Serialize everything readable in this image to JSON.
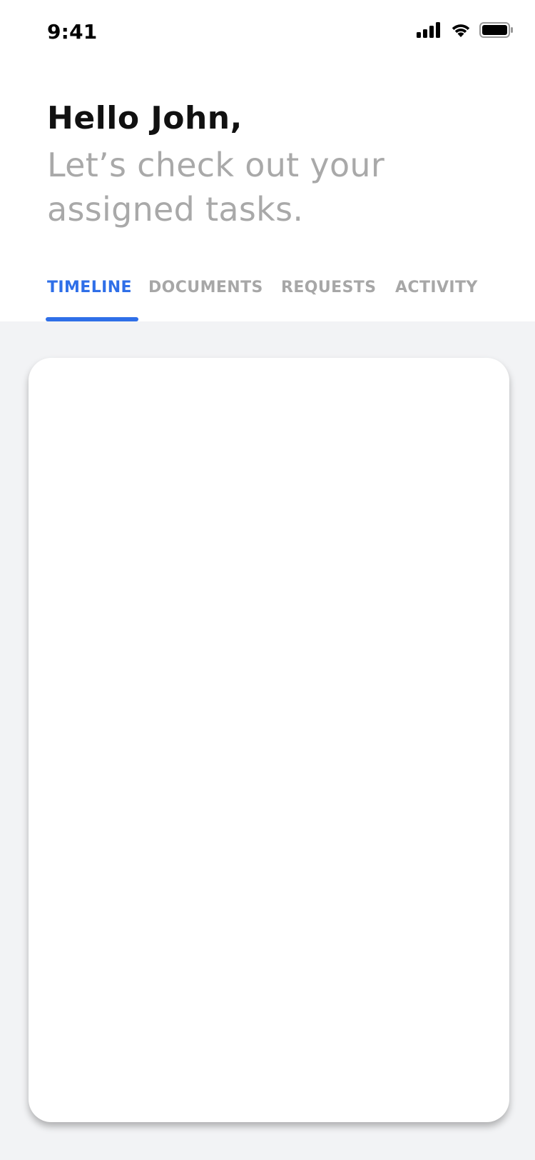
{
  "status_bar": {
    "time": "9:41",
    "icons": [
      "signal-icon",
      "wifi-icon",
      "battery-icon"
    ]
  },
  "header": {
    "greeting": "Hello John,",
    "subtitle": "Let’s check out your assigned tasks."
  },
  "tabs": [
    {
      "label": "TIMELINE",
      "active": true
    },
    {
      "label": "DOCUMENTS",
      "active": false
    },
    {
      "label": "REQUESTS",
      "active": false
    },
    {
      "label": "ACTIVITY",
      "active": false
    }
  ],
  "colors": {
    "accent": "#2f6fe8",
    "inactive_tab": "#a7a7a7",
    "subtitle": "#a9a9a9",
    "background": "#f2f3f5",
    "card": "#ffffff"
  }
}
